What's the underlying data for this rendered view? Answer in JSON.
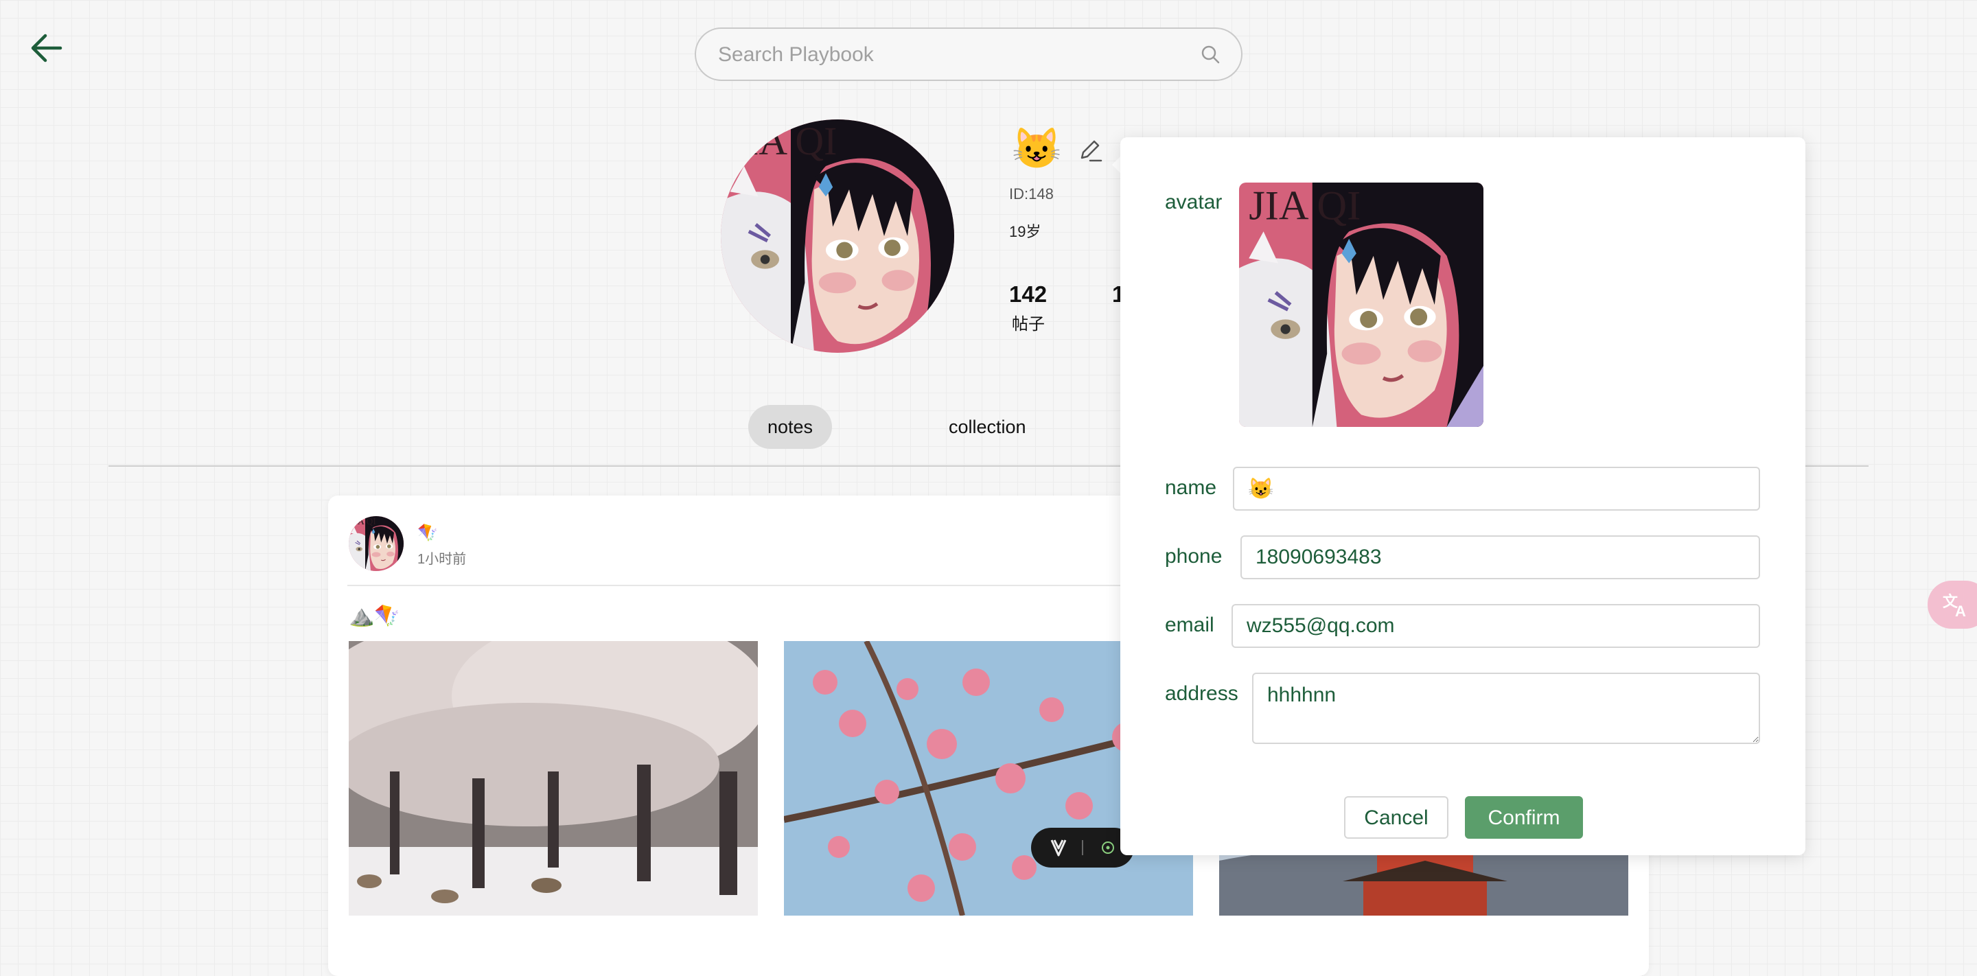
{
  "search": {
    "placeholder": "Search Playbook"
  },
  "profile": {
    "name": "😺",
    "id_text": "ID:148",
    "age_text": "19岁",
    "stats": [
      {
        "value": "142",
        "label": "帖子"
      },
      {
        "value": "1",
        "label": ""
      }
    ]
  },
  "tabs": [
    {
      "label": "notes",
      "active": true
    },
    {
      "label": "collection",
      "active": false
    }
  ],
  "post": {
    "author": "🪁",
    "time": "1小时前",
    "text": "⛰️🪁",
    "photos": [
      "cherry-blossom-deer-photo",
      "plum-blossom-photo",
      "pagoda-photo"
    ]
  },
  "modal": {
    "avatar_label": "avatar",
    "name_label": "name",
    "name_value": "😺",
    "phone_label": "phone",
    "phone_value": "18090693483",
    "email_label": "email",
    "email_value": "wz555@qq.com",
    "address_label": "address",
    "address_value": "hhhhnn",
    "cancel_label": "Cancel",
    "confirm_label": "Confirm"
  },
  "avatar_art_text": "JIA QI",
  "colors": {
    "accent": "#5b9e6b",
    "label": "#1d5d3a",
    "art_pink": "#d4617b"
  }
}
